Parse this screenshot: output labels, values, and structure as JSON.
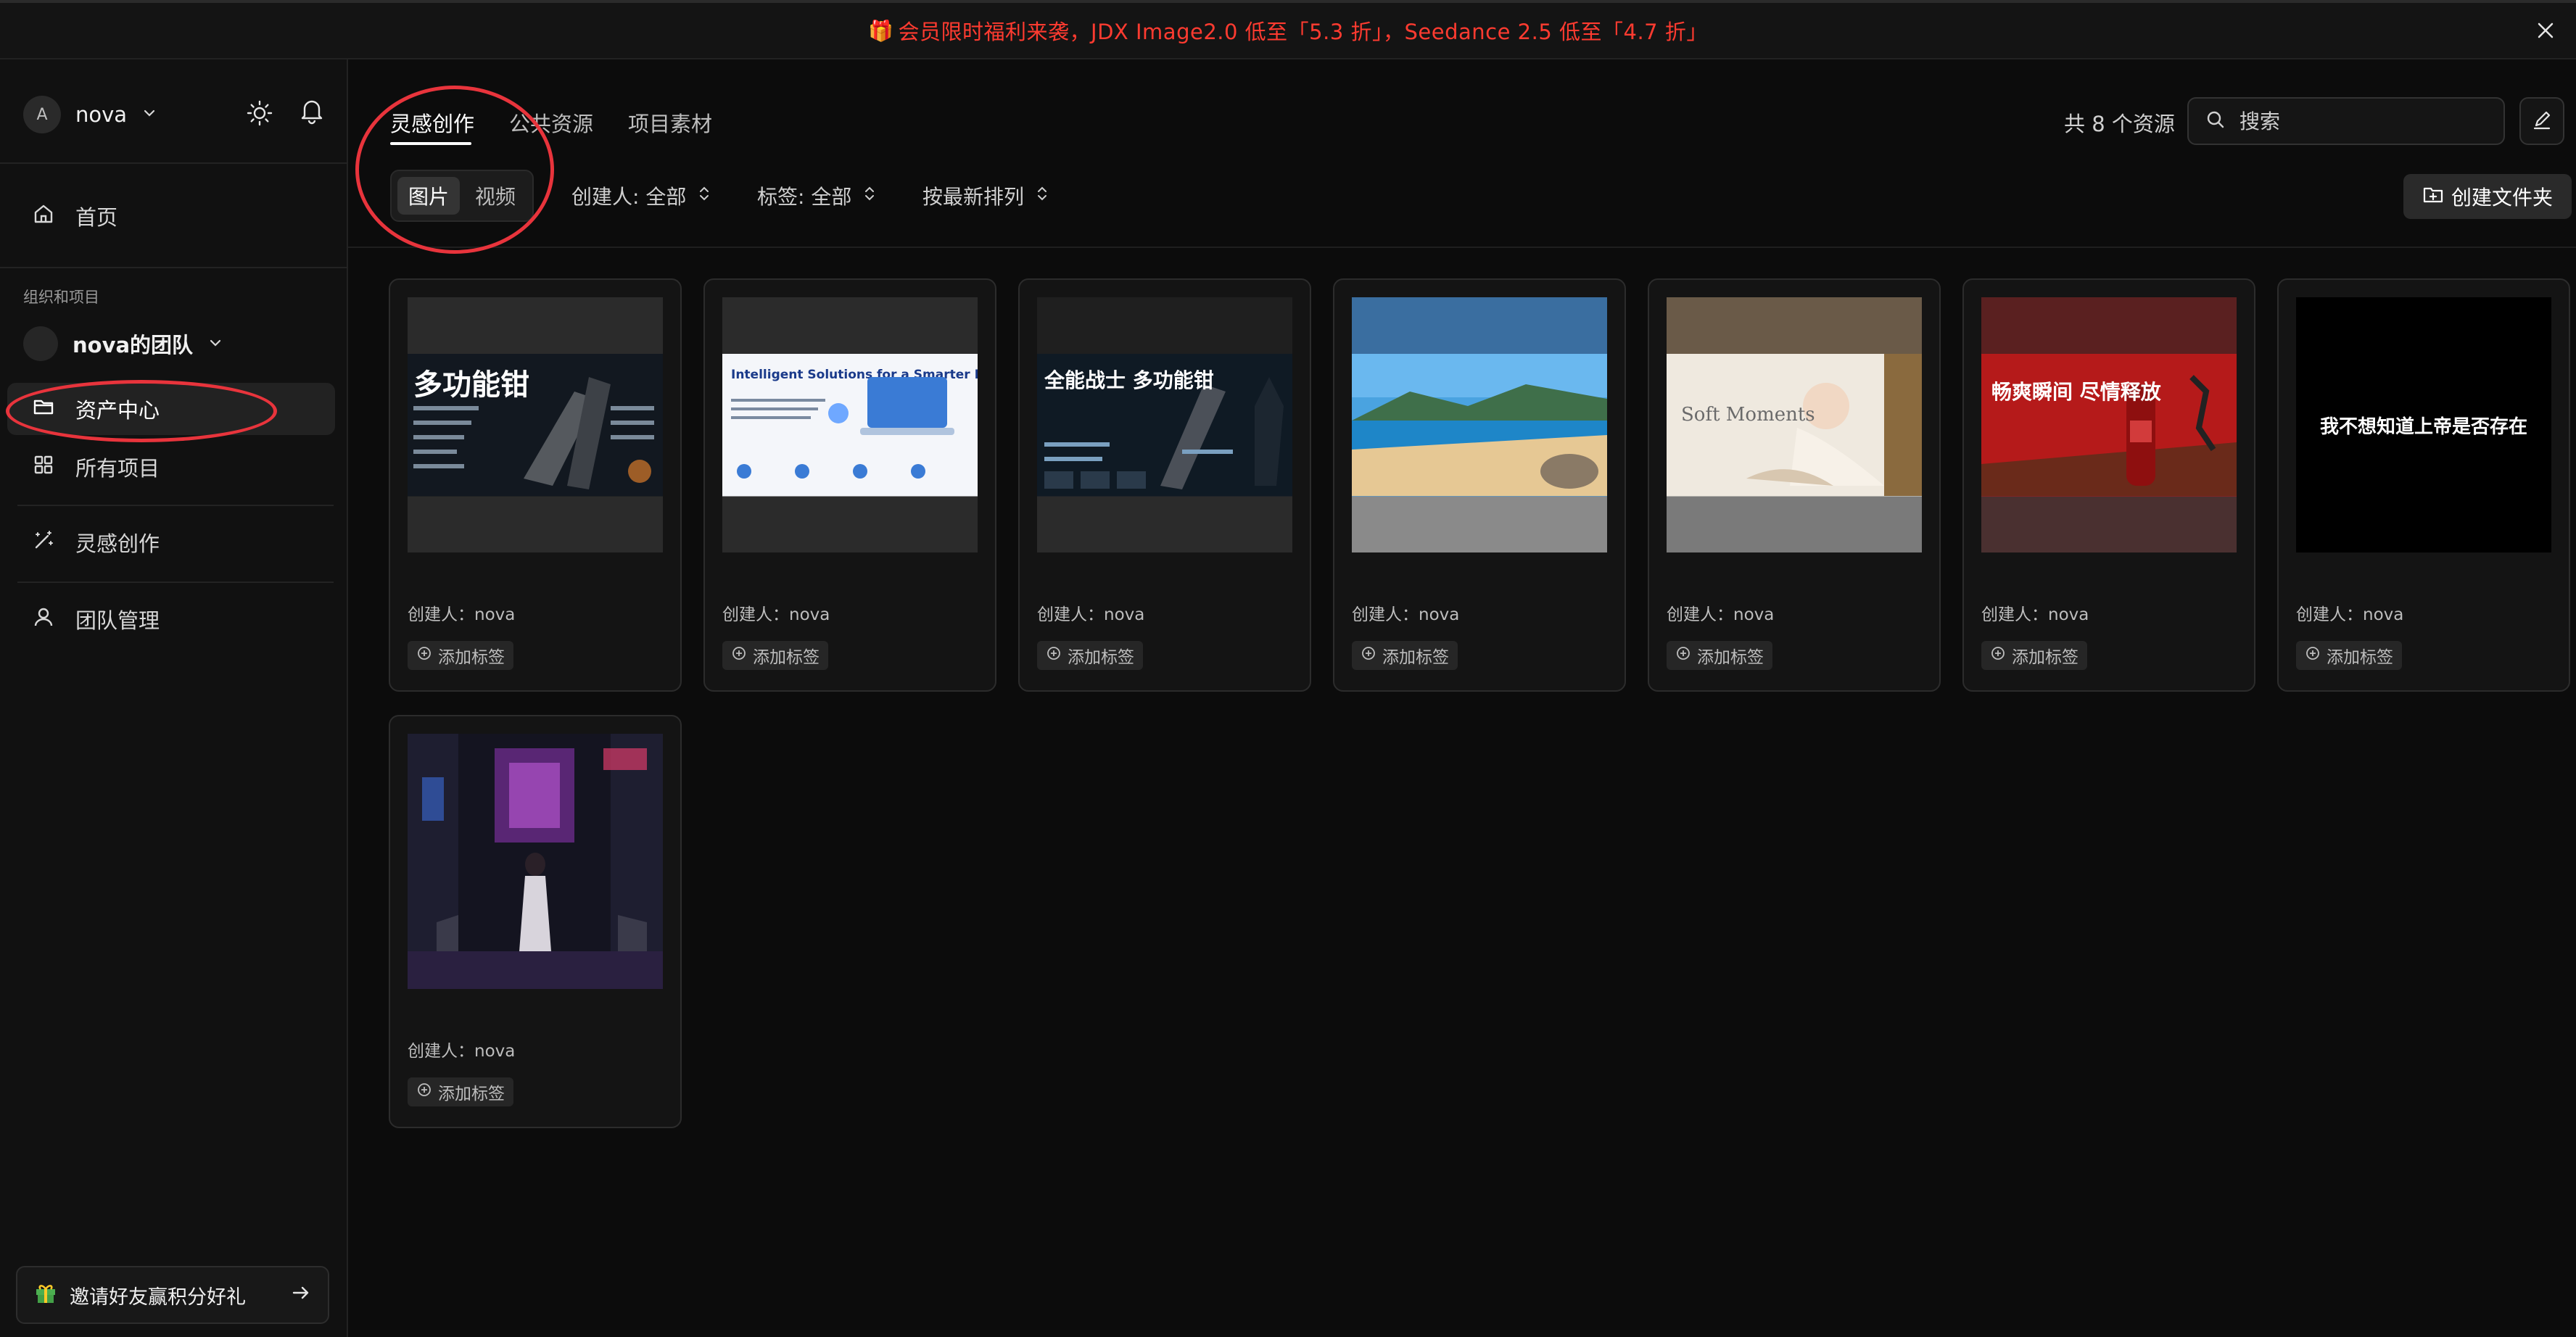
{
  "banner": {
    "text": "会员限时福利来袭，JDX Image2.0 低至「5.3 折」，Seedance 2.5 低至「4.7 折」"
  },
  "sidebar": {
    "user": {
      "avatar_letter": "A",
      "name": "nova"
    },
    "home_label": "首页",
    "section_label": "组织和项目",
    "team_name": "nova的团队",
    "items": [
      {
        "label": "资产中心"
      },
      {
        "label": "所有项目"
      },
      {
        "label": "灵感创作"
      },
      {
        "label": "团队管理"
      }
    ],
    "invite_label": "邀请好友赢积分好礼"
  },
  "tabs": [
    {
      "label": "灵感创作",
      "active": true
    },
    {
      "label": "公共资源"
    },
    {
      "label": "项目素材"
    }
  ],
  "resource_count": "共 8 个资源",
  "search": {
    "placeholder": "搜索"
  },
  "segment": [
    {
      "label": "图片",
      "active": true
    },
    {
      "label": "视频"
    }
  ],
  "filters": {
    "creator": "创建人: 全部",
    "tag": "标签: 全部",
    "sort": "按最新排列"
  },
  "create_folder_label": "创建文件夹",
  "cards": [
    {
      "creator": "创建人：nova",
      "add_tag": "添加标签",
      "image_title": "多功能钳"
    },
    {
      "creator": "创建人：nova",
      "add_tag": "添加标签",
      "image_title": "Intelligent Solutions for a Smarter Future"
    },
    {
      "creator": "创建人：nova",
      "add_tag": "添加标签",
      "image_title": "全能战士 多功能钳"
    },
    {
      "creator": "创建人：nova",
      "add_tag": "添加标签",
      "image_title": ""
    },
    {
      "creator": "创建人：nova",
      "add_tag": "添加标签",
      "image_title": "Soft Moments"
    },
    {
      "creator": "创建人：nova",
      "add_tag": "添加标签",
      "image_title": "畅爽瞬间 尽情释放"
    },
    {
      "creator": "创建人：nova",
      "add_tag": "添加标签",
      "image_title": "我不想知道上帝是否存在"
    },
    {
      "creator": "创建人：nova",
      "add_tag": "添加标签",
      "image_title": ""
    }
  ],
  "colors": {
    "accent_red": "#ff3b30",
    "annotation": "#e8343c",
    "bg": "#0c0c0c"
  }
}
